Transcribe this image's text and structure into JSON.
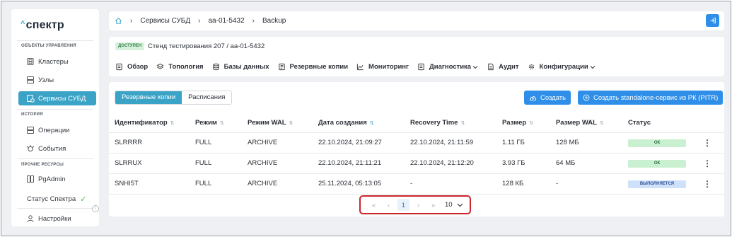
{
  "logo": {
    "caret": "^",
    "text": "спектр"
  },
  "sidebar": {
    "sections": {
      "management": "ОБЪЕКТЫ УПРАВЛЕНИЯ",
      "history": "ИСТОРИЯ",
      "other": "ПРОЧИЕ РЕСУРСЫ"
    },
    "items": [
      {
        "label": "Кластеры",
        "icon": "cluster-icon"
      },
      {
        "label": "Узлы",
        "icon": "server-icon"
      },
      {
        "label": "Сервисы СУБД",
        "icon": "database-service-icon",
        "active": true
      },
      {
        "label": "Операции",
        "icon": "operations-icon"
      },
      {
        "label": "События",
        "icon": "events-icon"
      },
      {
        "label": "PgAdmin",
        "icon": "pgadmin-icon"
      }
    ],
    "status_label": "Статус Спектра",
    "settings_label": "Настройки"
  },
  "breadcrumb": [
    "Сервисы СУБД",
    "aa-01-5432",
    "Backup"
  ],
  "header": {
    "badge": "ДОСТУПЕН",
    "stand": "Стенд тестирования 207 /  aa-01-5432",
    "nav": [
      {
        "label": "Обзор",
        "icon": "overview-icon"
      },
      {
        "label": "Топология",
        "icon": "topology-icon"
      },
      {
        "label": "Базы данных",
        "icon": "databases-icon"
      },
      {
        "label": "Резервные копии",
        "icon": "backups-icon"
      },
      {
        "label": "Мониторинг",
        "icon": "monitoring-icon"
      },
      {
        "label": "Диагностика",
        "icon": "diagnostics-icon",
        "dropdown": true
      },
      {
        "label": "Аудит",
        "icon": "audit-icon"
      },
      {
        "label": "Конфигурации",
        "icon": "settings-icon",
        "dropdown": true
      }
    ]
  },
  "tabs": {
    "backups": "Резервные копии",
    "schedules": "Расписания"
  },
  "buttons": {
    "create": "Создать",
    "create_pitr": "Создать standalone-сервис из РК (PITR)"
  },
  "table": {
    "columns": [
      "Идентификатор",
      "Режим",
      "Режим WAL",
      "Дата создания",
      "Recovery Time",
      "Размер",
      "Размер WAL",
      "Статус"
    ],
    "rows": [
      {
        "id": "SLRRRR",
        "mode": "FULL",
        "wal_mode": "ARCHIVE",
        "created": "22.10.2024, 21:09:27",
        "recovery": "22.10.2024, 21:11:59",
        "size": "1.11 ГБ",
        "wal_size": "128 МБ",
        "status": "ОК",
        "status_kind": "ok"
      },
      {
        "id": "SLRRUX",
        "mode": "FULL",
        "wal_mode": "ARCHIVE",
        "created": "22.10.2024, 21:11:21",
        "recovery": "22.10.2024, 21:12:20",
        "size": "3.93 ГБ",
        "wal_size": "64 МБ",
        "status": "ОК",
        "status_kind": "ok"
      },
      {
        "id": "SNHI5T",
        "mode": "FULL",
        "wal_mode": "ARCHIVE",
        "created": "25.11.2024, 05:13:05",
        "recovery": "-",
        "size": "128 КБ",
        "wal_size": "-",
        "status": "ВЫПОЛНЯЕТСЯ",
        "status_kind": "running"
      }
    ]
  },
  "pagination": {
    "first": "«",
    "prev": "‹",
    "current_page": "1",
    "next": "›",
    "last": "»",
    "page_size": "10"
  },
  "colors": {
    "accent": "#3aa3c6",
    "primary": "#2f8fe8",
    "ok": "#c9f0d0",
    "running": "#cfe0fb",
    "highlight": "#c9252c"
  }
}
